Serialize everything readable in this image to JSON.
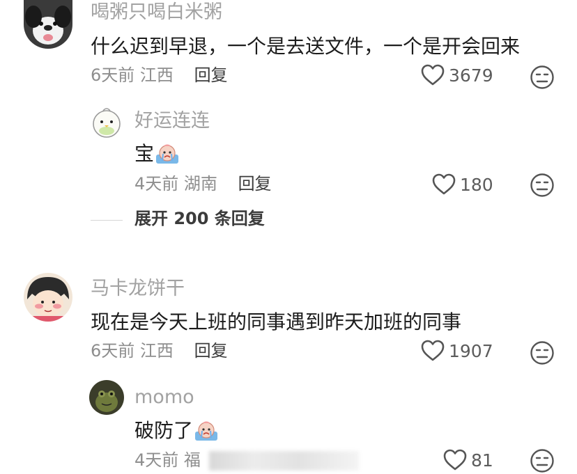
{
  "comments": [
    {
      "username": "喝粥只喝白米粥",
      "text": "什么迟到早退，一个是去送文件，一个是开会回来",
      "time": "6天前",
      "location": "江西",
      "reply_label": "回复",
      "likes": "3679",
      "replies": [
        {
          "username": "好运连连",
          "text": "宝",
          "time": "4天前",
          "location": "湖南",
          "reply_label": "回复",
          "likes": "180"
        }
      ],
      "expand_label": "展开 200 条回复"
    },
    {
      "username": "马卡龙饼干",
      "text": "现在是今天上班的同事遇到昨天加班的同事",
      "time": "6天前",
      "location": "江西",
      "reply_label": "回复",
      "likes": "1907",
      "replies": [
        {
          "username": "momo",
          "text": "破防了",
          "time": "4天前",
          "location": "福",
          "likes": "81"
        }
      ]
    }
  ],
  "icons": {
    "like": "heart-outline-icon",
    "dislike": "meh-face-icon",
    "sticker": "crying-sticker-icon"
  },
  "colors": {
    "username": "#a2a2a2",
    "text": "#1c1c1c",
    "meta": "#8e8e8e",
    "reply": "#3b3b3b"
  }
}
